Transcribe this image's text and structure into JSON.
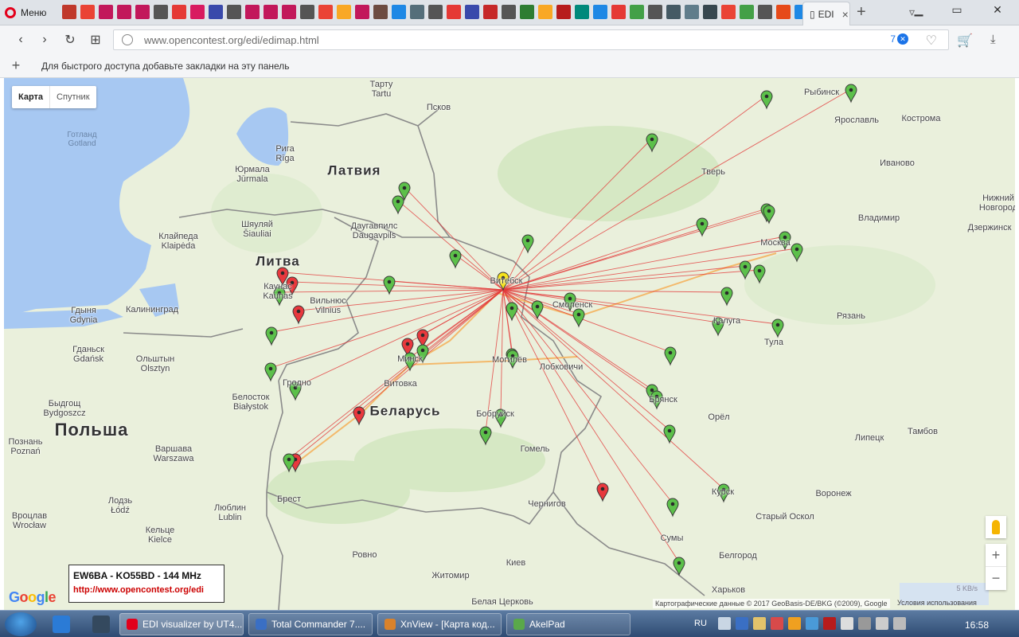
{
  "browser": {
    "menu_label": "Меню",
    "active_tab_title": "EDI",
    "pinned_tabs": [
      {
        "icon": "bookmark-icon",
        "color": "#c0392b"
      },
      {
        "icon": "google-icon",
        "color": "#ea4335"
      },
      {
        "icon": "qrz-ham-icon",
        "color": "#c2185b"
      },
      {
        "icon": "qrz-ham-icon",
        "color": "#c2185b"
      },
      {
        "icon": "qrz-ham-icon",
        "color": "#c2185b"
      },
      {
        "icon": "page-icon",
        "color": "#555555"
      },
      {
        "icon": "pause-icon",
        "color": "#e53935"
      },
      {
        "icon": "fm-icon",
        "color": "#d81b60"
      },
      {
        "icon": "image-icon",
        "color": "#3949ab"
      },
      {
        "icon": "page-icon",
        "color": "#555555"
      },
      {
        "icon": "qrz-ham-icon",
        "color": "#c2185b"
      },
      {
        "icon": "qrz-ham-icon",
        "color": "#c2185b"
      },
      {
        "icon": "qrz-ham-icon",
        "color": "#c2185b"
      },
      {
        "icon": "page-icon",
        "color": "#555555"
      },
      {
        "icon": "google-icon",
        "color": "#ea4335"
      },
      {
        "icon": "mail-icon",
        "color": "#f9a825"
      },
      {
        "icon": "qrz-ham-icon",
        "color": "#c2185b"
      },
      {
        "icon": "picture-icon",
        "color": "#6d4c41"
      },
      {
        "icon": "arrow-icon",
        "color": "#1e88e5"
      },
      {
        "icon": "game-icon",
        "color": "#546e7a"
      },
      {
        "icon": "page-icon",
        "color": "#555555"
      },
      {
        "icon": "flower-icon",
        "color": "#e53935"
      },
      {
        "icon": "ribbon-icon",
        "color": "#3949ab"
      },
      {
        "icon": "rc-icon",
        "color": "#c62828"
      },
      {
        "icon": "page-icon",
        "color": "#555555"
      },
      {
        "icon": "ay-icon",
        "color": "#2e7d32"
      },
      {
        "icon": "smile-icon",
        "color": "#f9a825"
      },
      {
        "icon": "record-icon",
        "color": "#b71c1c"
      },
      {
        "icon": "globe-icon",
        "color": "#00897b"
      },
      {
        "icon": "drop-icon",
        "color": "#1e88e5"
      },
      {
        "icon": "flag-icon",
        "color": "#e53935"
      },
      {
        "icon": "check-icon",
        "color": "#43a047"
      },
      {
        "icon": "page-icon",
        "color": "#555555"
      },
      {
        "icon": "t-icon",
        "color": "#455a64"
      },
      {
        "icon": "gear-icon",
        "color": "#607d8b"
      },
      {
        "icon": "film-icon",
        "color": "#37474f"
      },
      {
        "icon": "google-icon",
        "color": "#ea4335"
      },
      {
        "icon": "doc-icon",
        "color": "#43a047"
      },
      {
        "icon": "page-icon",
        "color": "#555555"
      },
      {
        "icon": "box-icon",
        "color": "#e64a19"
      },
      {
        "icon": "windows-icon",
        "color": "#1e88e5"
      }
    ],
    "url": "www.opencontest.org/edi/edimap.html",
    "url_count": "7",
    "bookmarks_hint": "Для быстрого доступа добавьте закладки на эту панель"
  },
  "map": {
    "type_buttons": [
      "Карта",
      "Спутник"
    ],
    "infobox": {
      "title": "EW6BA - KO55BD - 144 MHz",
      "link": "http://www.opencontest.org/edi"
    },
    "google_logo": "Google",
    "attribution": "Картографические данные © 2017 GeoBasis-DE/BKG (©2009), Google",
    "terms": "Условия использования",
    "speed": "5 KB/s",
    "zoom_in": "+",
    "zoom_out": "−",
    "labels": [
      {
        "text": "Тарту\nTartu",
        "cls": "city"
      },
      {
        "text": "Псков",
        "cls": "city"
      },
      {
        "text": "Рыбинск",
        "cls": "city"
      },
      {
        "text": "Ярославль",
        "cls": "city"
      },
      {
        "text": "Кострома",
        "cls": "city"
      },
      {
        "text": "Готланд\nGotland",
        "cls": "sea"
      },
      {
        "text": "Рига\nRīga",
        "cls": "city"
      },
      {
        "text": "Латвия",
        "cls": "country"
      },
      {
        "text": "Тверь",
        "cls": "city"
      },
      {
        "text": "Иваново",
        "cls": "city"
      },
      {
        "text": "Юрмала\nJūrmala",
        "cls": "city"
      },
      {
        "text": "Нижний\nНовгород",
        "cls": "city"
      },
      {
        "text": "Шяуляй\nŠiauliai",
        "cls": "city"
      },
      {
        "text": "Даугавпилс\nDaugavpils",
        "cls": "city"
      },
      {
        "text": "Владимир",
        "cls": "city"
      },
      {
        "text": "Дзержинск",
        "cls": "city"
      },
      {
        "text": "Клайпеда\nKlaipėda",
        "cls": "city"
      },
      {
        "text": "Москва",
        "cls": "city"
      },
      {
        "text": "Литва",
        "cls": "country"
      },
      {
        "text": "Витебск",
        "cls": "city"
      },
      {
        "text": "Каунас\nKaunas",
        "cls": "city"
      },
      {
        "text": "Вильнюс\nVilnius",
        "cls": "city"
      },
      {
        "text": "Смоленск",
        "cls": "city"
      },
      {
        "text": "Калининград",
        "cls": "city"
      },
      {
        "text": "Гдыня\nGdynia",
        "cls": "city"
      },
      {
        "text": "Калуга",
        "cls": "city"
      },
      {
        "text": "Рязань",
        "cls": "city"
      },
      {
        "text": "Тула",
        "cls": "city"
      },
      {
        "text": "Гданьск\nGdańsk",
        "cls": "city"
      },
      {
        "text": "Минск",
        "cls": "city"
      },
      {
        "text": "Могилёв",
        "cls": "city"
      },
      {
        "text": "Лобковичи",
        "cls": "city"
      },
      {
        "text": "Ольштын\nOlsztyn",
        "cls": "city"
      },
      {
        "text": "Гродно",
        "cls": "city"
      },
      {
        "text": "Витовка",
        "cls": "city"
      },
      {
        "text": "Брянск",
        "cls": "city"
      },
      {
        "text": "Быдгощ\nBydgoszcz",
        "cls": "city"
      },
      {
        "text": "Белосток\nBiałystok",
        "cls": "city"
      },
      {
        "text": "Беларусь",
        "cls": "country"
      },
      {
        "text": "Бобруйск",
        "cls": "city"
      },
      {
        "text": "Орёл",
        "cls": "city"
      },
      {
        "text": "Польша",
        "cls": "country-l"
      },
      {
        "text": "Тамбов",
        "cls": "city"
      },
      {
        "text": "Липецк",
        "cls": "city"
      },
      {
        "text": "Познань\nPoznań",
        "cls": "city"
      },
      {
        "text": "Варшава\nWarszawa",
        "cls": "city"
      },
      {
        "text": "Гомель",
        "cls": "city"
      },
      {
        "text": "Брест",
        "cls": "city"
      },
      {
        "text": "Лодзь\nŁódź",
        "cls": "city"
      },
      {
        "text": "Курск",
        "cls": "city"
      },
      {
        "text": "Воронеж",
        "cls": "city"
      },
      {
        "text": "Чернигов",
        "cls": "city"
      },
      {
        "text": "Люблин\nLublin",
        "cls": "city"
      },
      {
        "text": "Старый Оскол",
        "cls": "city"
      },
      {
        "text": "Вроцлав\nWrocław",
        "cls": "city"
      },
      {
        "text": "Кельце\nKielce",
        "cls": "city"
      },
      {
        "text": "Сумы",
        "cls": "city"
      },
      {
        "text": "Белгород",
        "cls": "city"
      },
      {
        "text": "Ровно",
        "cls": "city"
      },
      {
        "text": "Киев",
        "cls": "city"
      },
      {
        "text": "Житомир",
        "cls": "city"
      },
      {
        "text": "Харьков",
        "cls": "city"
      },
      {
        "text": "Белая Церковь",
        "cls": "city"
      }
    ],
    "markers": [
      {
        "color": "green"
      },
      {
        "color": "green"
      },
      {
        "color": "green"
      },
      {
        "color": "green"
      },
      {
        "color": "green"
      },
      {
        "color": "green"
      },
      {
        "color": "green"
      },
      {
        "color": "green"
      },
      {
        "color": "green"
      },
      {
        "color": "green"
      },
      {
        "color": "green"
      },
      {
        "color": "green"
      },
      {
        "color": "green"
      },
      {
        "color": "green"
      },
      {
        "color": "green"
      },
      {
        "color": "green"
      },
      {
        "color": "green"
      },
      {
        "color": "green"
      },
      {
        "color": "green"
      },
      {
        "color": "green"
      },
      {
        "color": "red"
      },
      {
        "color": "red"
      },
      {
        "color": "red"
      },
      {
        "color": "green"
      },
      {
        "color": "green"
      },
      {
        "color": "green"
      },
      {
        "color": "red"
      },
      {
        "color": "red"
      },
      {
        "color": "green"
      },
      {
        "color": "green"
      },
      {
        "color": "green"
      },
      {
        "color": "green"
      },
      {
        "color": "green"
      },
      {
        "color": "green"
      },
      {
        "color": "green"
      },
      {
        "color": "red"
      },
      {
        "color": "green"
      },
      {
        "color": "green"
      },
      {
        "color": "green"
      },
      {
        "color": "green"
      },
      {
        "color": "green"
      },
      {
        "color": "red"
      },
      {
        "color": "green"
      },
      {
        "color": "red"
      },
      {
        "color": "green"
      },
      {
        "color": "green"
      },
      {
        "color": "green"
      },
      {
        "color": "green"
      }
    ],
    "home_marker": {
      "color": "yellow"
    },
    "colors": {
      "green": "#5cc04a",
      "red": "#e8383d",
      "yellow": "#f5e21b",
      "line": "#e23a3a",
      "water": "#a7c8f2",
      "land": "#eaf0dc"
    }
  },
  "taskbar": {
    "tasks": [
      {
        "label": "EDI visualizer by UT4...",
        "icon": "opera-icon",
        "color": "#e3001b",
        "active": true
      },
      {
        "label": "Total Commander 7....",
        "icon": "total-commander-icon",
        "color": "#3a6fc4",
        "active": false
      },
      {
        "label": "XnView - [Карта код...",
        "icon": "xnview-icon",
        "color": "#d9822b",
        "active": false
      },
      {
        "label": "AkelPad",
        "icon": "akelpad-icon",
        "color": "#5aa84a",
        "active": false
      }
    ],
    "lang": "RU",
    "clock": "16:58"
  }
}
